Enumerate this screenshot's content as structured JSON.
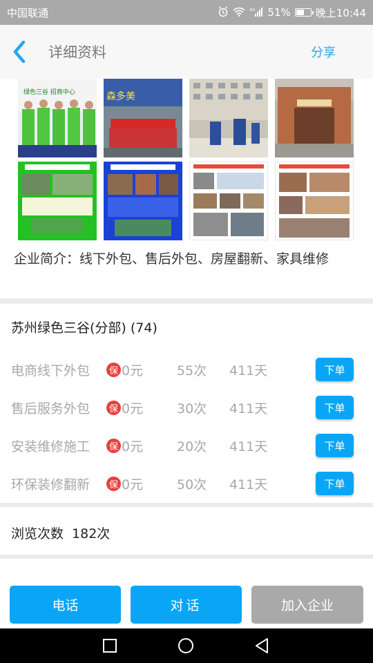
{
  "status_bar": {
    "carrier": "中国联通",
    "network": "4G",
    "battery": "51%",
    "battery_level": 0.51,
    "time": "晚上10:44",
    "icons": [
      "alarm-icon",
      "wifi-icon",
      "signal-icon",
      "battery-icon"
    ]
  },
  "header": {
    "back_icon": "chevron-left-icon",
    "title": "详细资料",
    "share_label": "分享"
  },
  "photos": {
    "row1": [
      {
        "name": "photo-team-green",
        "caption": "绿色三谷 招商中心"
      },
      {
        "name": "photo-team-banner",
        "caption": "森多美"
      },
      {
        "name": "photo-building-workers",
        "caption": ""
      },
      {
        "name": "photo-entrance",
        "caption": ""
      }
    ],
    "row2": [
      {
        "name": "photo-flyer-green",
        "caption": ""
      },
      {
        "name": "photo-flyer-blue",
        "caption": ""
      },
      {
        "name": "photo-brochure-1",
        "caption": ""
      },
      {
        "name": "photo-brochure-2",
        "caption": ""
      }
    ]
  },
  "intro": {
    "text": "企业简介：线下外包、售后外包、房屋翻新、家具维修"
  },
  "company": {
    "name": "苏州绿色三谷(分部) (74)"
  },
  "services": [
    {
      "name": "电商线下外包",
      "badge": "保",
      "price": "0元",
      "count": "55次",
      "days": "411天",
      "button": "下单"
    },
    {
      "name": "售后服务外包",
      "badge": "保",
      "price": "0元",
      "count": "30次",
      "days": "411天",
      "button": "下单"
    },
    {
      "name": "安装维修施工",
      "badge": "保",
      "price": "0元",
      "count": "20次",
      "days": "411天",
      "button": "下单"
    },
    {
      "name": "环保装修翻新",
      "badge": "保",
      "price": "0元",
      "count": "50次",
      "days": "411天",
      "button": "下单"
    }
  ],
  "views": {
    "label": "浏览次数",
    "count": "182次"
  },
  "actions": {
    "call": "电话",
    "chat": "对话",
    "join": "加入企业"
  },
  "colors": {
    "accent": "#0aa6f5",
    "badge": "#e8403e",
    "disabled": "#a9a9a9",
    "status_bar": "#a9a9a9"
  },
  "nav": {
    "icons": [
      "recents-icon",
      "home-icon",
      "back-icon"
    ]
  }
}
